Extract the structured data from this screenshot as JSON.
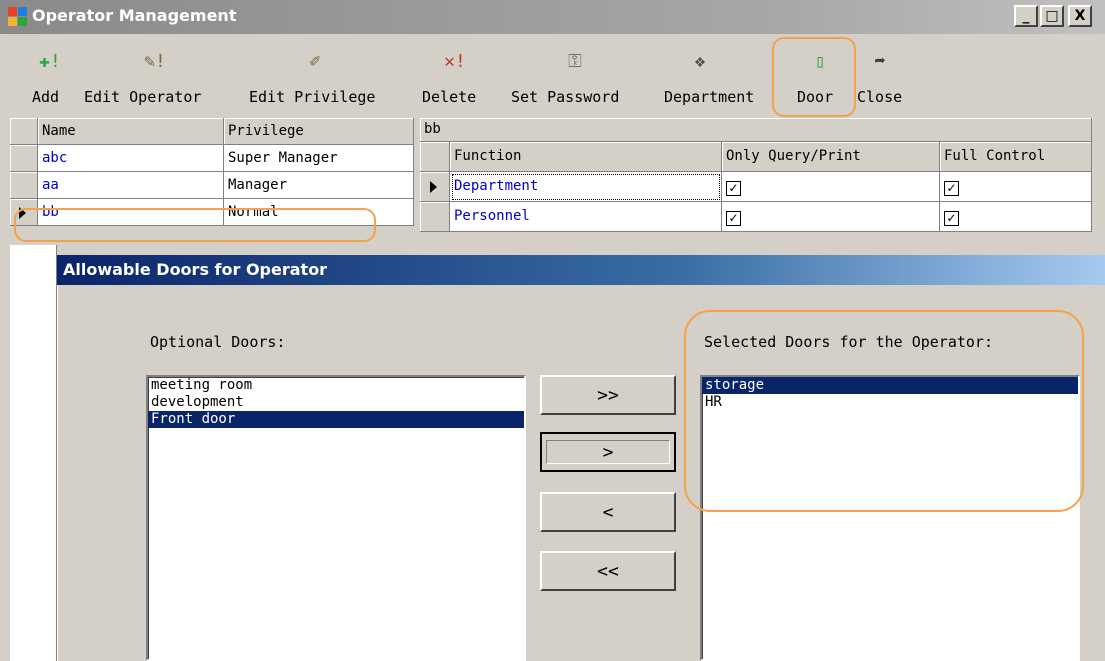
{
  "window": {
    "title": "Operator Management",
    "controls": [
      "_",
      "□",
      "X"
    ]
  },
  "toolbar": [
    {
      "label": "Add",
      "icon": "add-icon",
      "glyph": "✚!"
    },
    {
      "label": "Edit Operator",
      "icon": "pencil-icon",
      "glyph": "✎!"
    },
    {
      "label": "Edit Privilege",
      "icon": "edit-privilege-icon",
      "glyph": "✐"
    },
    {
      "label": "Delete",
      "icon": "delete-icon",
      "glyph": "✕!"
    },
    {
      "label": "Set Password",
      "icon": "key-icon",
      "glyph": "⚿"
    },
    {
      "label": "Department",
      "icon": "department-icon",
      "glyph": "❖"
    },
    {
      "label": "Door",
      "icon": "door-icon",
      "glyph": "▯"
    },
    {
      "label": "Close",
      "icon": "close-arrow-icon",
      "glyph": "➦"
    }
  ],
  "operators": {
    "headers": [
      "Name",
      "Privilege"
    ],
    "rows": [
      {
        "name": "abc",
        "privilege": "Super Manager"
      },
      {
        "name": "aa",
        "privilege": "Manager"
      },
      {
        "name": "bb",
        "privilege": "Normal"
      }
    ]
  },
  "privileges": {
    "selected_operator": "bb",
    "headers": [
      "Function",
      "Only Query/Print",
      "Full Control"
    ],
    "rows": [
      {
        "function": "Department",
        "query": "✓",
        "full": "✓"
      },
      {
        "function": "Personnel",
        "query": "✓",
        "full": "✓"
      }
    ]
  },
  "dialog": {
    "title": "Allowable Doors for Operator",
    "optional_label": "Optional Doors:",
    "selected_label": "Selected Doors for the Operator:",
    "optional_doors": [
      "meeting room",
      "development",
      "Front door"
    ],
    "selected_doors": [
      "storage",
      "HR"
    ],
    "buttons": {
      "add_all": ">>",
      "add_one": ">",
      "remove_one": "<",
      "remove_all": "<<"
    }
  },
  "colors": {
    "highlight": "#f5a14a",
    "selection": "#0a246a",
    "link": "#0000c8"
  }
}
